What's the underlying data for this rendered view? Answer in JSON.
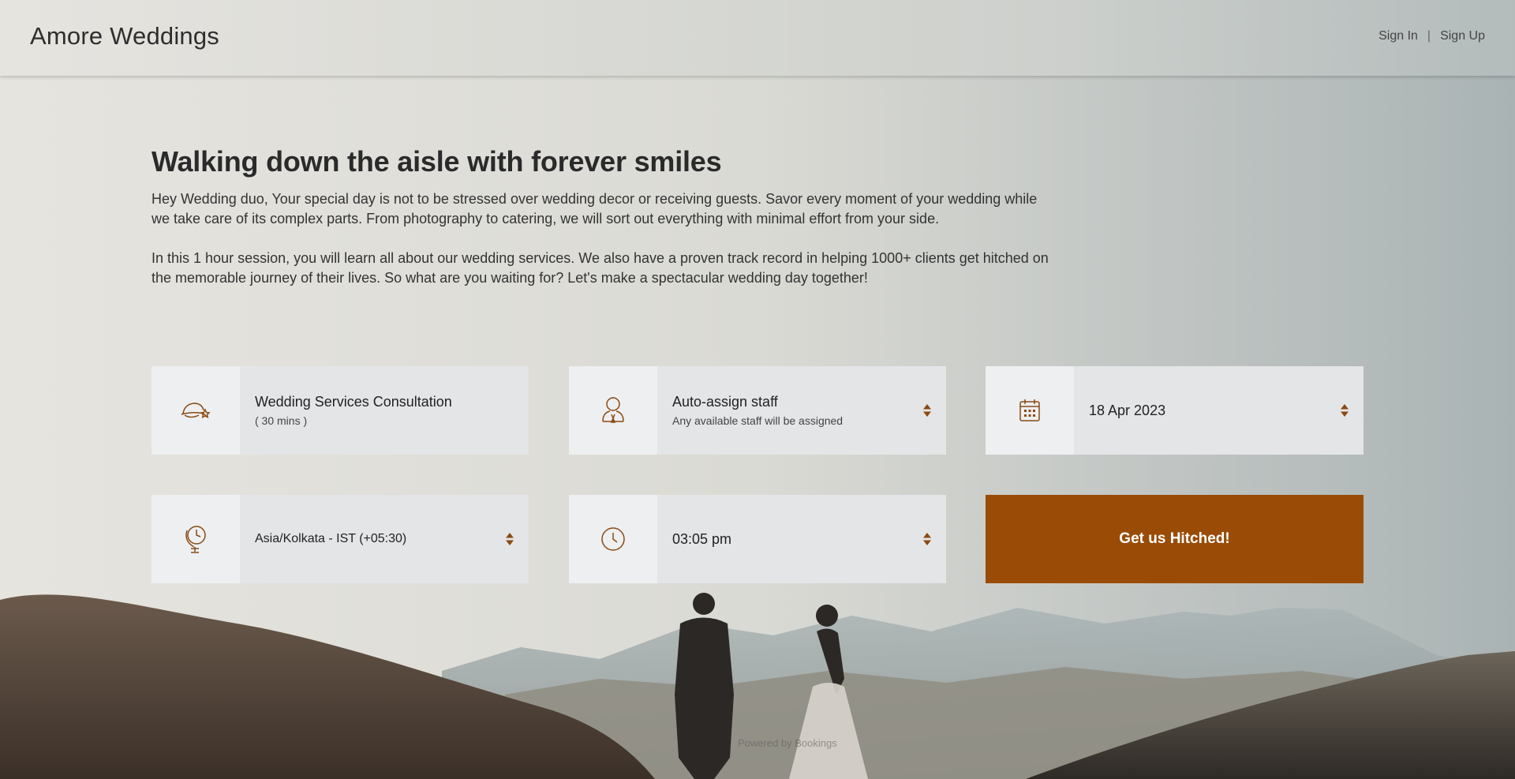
{
  "header": {
    "brand": "Amore Weddings",
    "sign_in": "Sign In",
    "separator": "|",
    "sign_up": "Sign Up"
  },
  "hero": {
    "title": "Walking down the aisle with forever smiles",
    "paragraph_1": "Hey Wedding duo, Your special day is not to be stressed over wedding decor or receiving guests. Savor every moment of your wedding while we take care of its complex parts. From photography to catering, we will sort out everything with minimal effort from your side.",
    "paragraph_2": "In this 1 hour session, you will learn all about our wedding services. We also have a proven track record in helping 1000+ clients get hitched on the memorable journey of their lives.  So what are you waiting for? Let's make a spectacular wedding day together!"
  },
  "booking": {
    "service": {
      "icon": "hat-star-icon",
      "title": "Wedding Services Consultation",
      "duration": "( 30 mins )"
    },
    "staff": {
      "icon": "person-icon",
      "title": "Auto-assign staff",
      "subtitle": "Any available staff will be assigned"
    },
    "date": {
      "icon": "calendar-icon",
      "value": "18 Apr 2023"
    },
    "timezone": {
      "icon": "globe-clock-icon",
      "value": "Asia/Kolkata - IST (+05:30)"
    },
    "time": {
      "icon": "clock-icon",
      "value": "03:05 pm"
    },
    "submit_label": "Get us Hitched!"
  },
  "footer": {
    "note": "Powered by Bookings"
  },
  "colors": {
    "accent": "#9a4c06",
    "icon": "#8a4a12",
    "card_bg": "#e4e5e7",
    "icon_bg": "#eeeff1"
  }
}
